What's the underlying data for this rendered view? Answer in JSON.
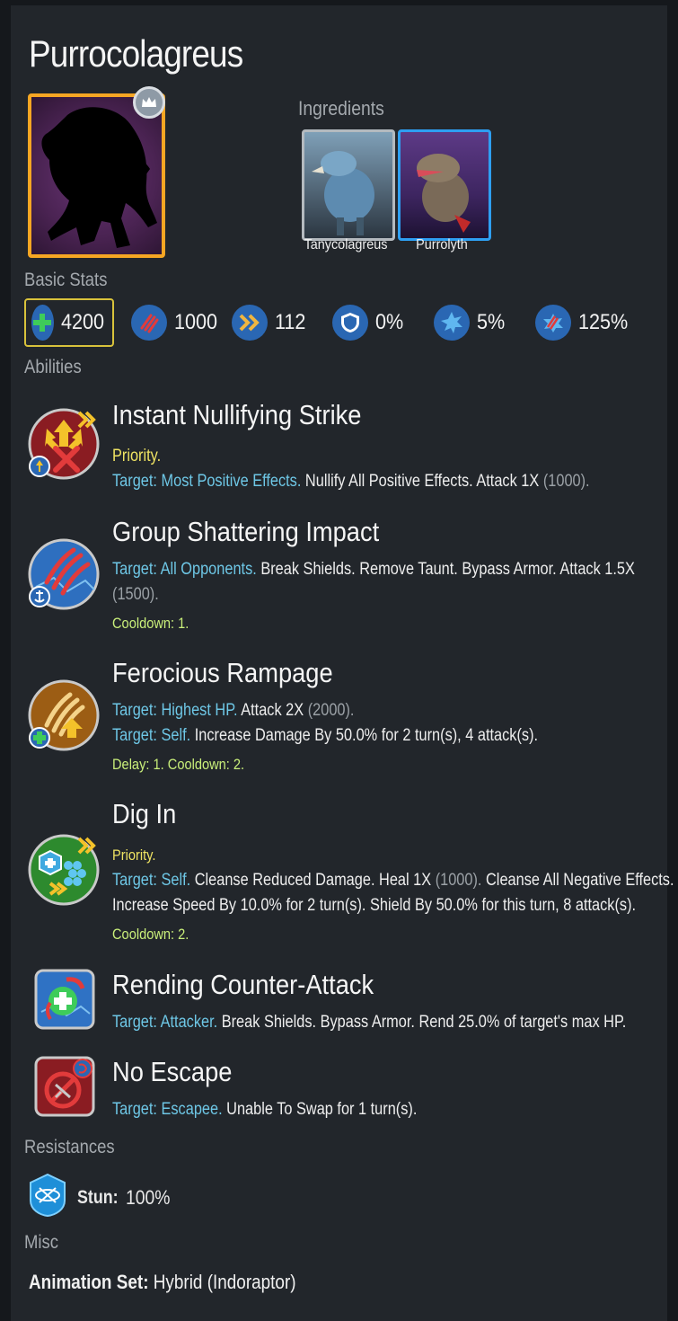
{
  "creature": {
    "name": "Purrocolagreus"
  },
  "ingredients": {
    "label": "Ingredients",
    "items": [
      {
        "name": "Tanycolagreus"
      },
      {
        "name": "Purrolyth"
      }
    ]
  },
  "basic_stats": {
    "label": "Basic Stats",
    "items": [
      {
        "icon": "health-icon",
        "value": "4200",
        "color": "#3ecc5a"
      },
      {
        "icon": "damage-icon",
        "value": "1000",
        "color": "#e23b3b"
      },
      {
        "icon": "speed-icon",
        "value": "112",
        "color": "#f0b640"
      },
      {
        "icon": "armor-icon",
        "value": "0%",
        "color": "#2a67b3"
      },
      {
        "icon": "crit-chance-icon",
        "value": "5%",
        "color": "#2a67b3"
      },
      {
        "icon": "crit-multiplier-icon",
        "value": "125%",
        "color": "#e23b3b"
      }
    ]
  },
  "abilities": {
    "label": "Abilities",
    "items": [
      {
        "name": "Instant Nullifying Strike",
        "priority": "Priority.",
        "target_label": "Target: Most Positive Effects.",
        "effect": "Nullify All Positive Effects. Attack 1X",
        "value": "(1000)."
      },
      {
        "name": "Group Shattering Impact",
        "target_label": "Target: All Opponents.",
        "effect": "Break Shields. Remove Taunt. Bypass Armor. Attack 1.5X",
        "value": "(1500).",
        "cooldown": "Cooldown: 1."
      },
      {
        "name": "Ferocious Rampage",
        "target_label": "Target: Highest HP.",
        "effect": "Attack 2X",
        "value": "(2000).",
        "target2_label": "Target: Self.",
        "effect2": "Increase Damage By 50.0% for 2 turn(s), 4 attack(s).",
        "cooldown": "Delay: 1. Cooldown: 2."
      },
      {
        "name": "Dig In",
        "priority": "Priority.",
        "target_label": "Target: Self.",
        "effect": "Cleanse Reduced Damage. Heal 1X",
        "value": "(1000).",
        "effect_tail": "Cleanse All Negative Effects.",
        "effect2": "Increase Speed By 10.0% for 2 turn(s). Shield By 50.0% for this turn, 8 attack(s).",
        "cooldown": "Cooldown: 2."
      },
      {
        "name": "Rending Counter-Attack",
        "target_label": "Target: Attacker.",
        "effect": "Break Shields. Bypass Armor. Rend 25.0% of target's max HP."
      },
      {
        "name": "No Escape",
        "target_label": "Target: Escapee.",
        "effect": "Unable To Swap for 1 turn(s)."
      }
    ]
  },
  "resistances": {
    "label": "Resistances",
    "items": [
      {
        "icon": "stun-icon",
        "label": "Stun:",
        "value": "100%"
      }
    ]
  },
  "misc": {
    "label": "Misc",
    "animation_label": "Animation Set:",
    "animation_value": "Hybrid (Indoraptor)"
  }
}
